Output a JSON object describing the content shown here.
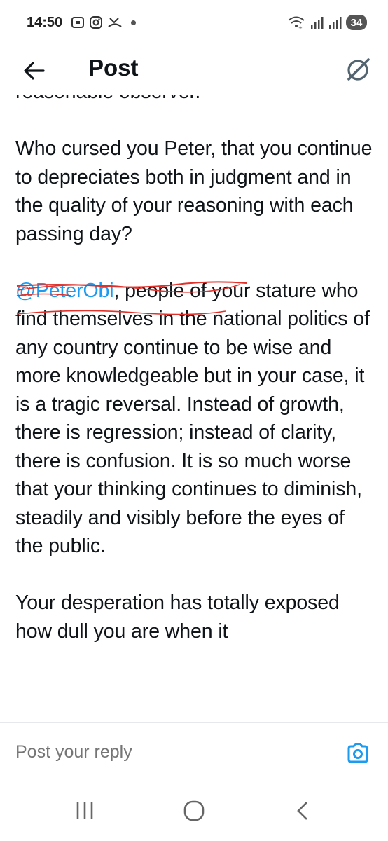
{
  "status_bar": {
    "time": "14:50",
    "battery": "34"
  },
  "header": {
    "title": "Post"
  },
  "post": {
    "paragraphs": [
      {
        "text": "reasonable observer."
      },
      {
        "text": "Who cursed you Peter, that you continue to depreciates both in judgment and in the quality of your reasoning with each passing day?"
      },
      {
        "mention": "@PeterObi",
        "text": ", people of your stature who find themselves in the national politics of any country continue to be wise and more knowledgeable but in your case, it is a tragic reversal. Instead of growth, there is regression; instead of clarity, there is confusion. It is so much worse that your thinking continues to diminish, steadily and visibly before the eyes of the public."
      },
      {
        "text": "Your desperation has totally exposed how dull you are when it"
      }
    ],
    "mention_color": "#1d9bf0",
    "annotation_color": "#e0312b"
  },
  "reply": {
    "placeholder": "Post your reply"
  },
  "colors": {
    "accent": "#1d9bf0",
    "text": "#0f1419",
    "muted": "#536471"
  },
  "icons": [
    "back-arrow-icon",
    "grok-icon",
    "camera-icon",
    "recents-icon",
    "home-icon",
    "back-nav-icon"
  ]
}
